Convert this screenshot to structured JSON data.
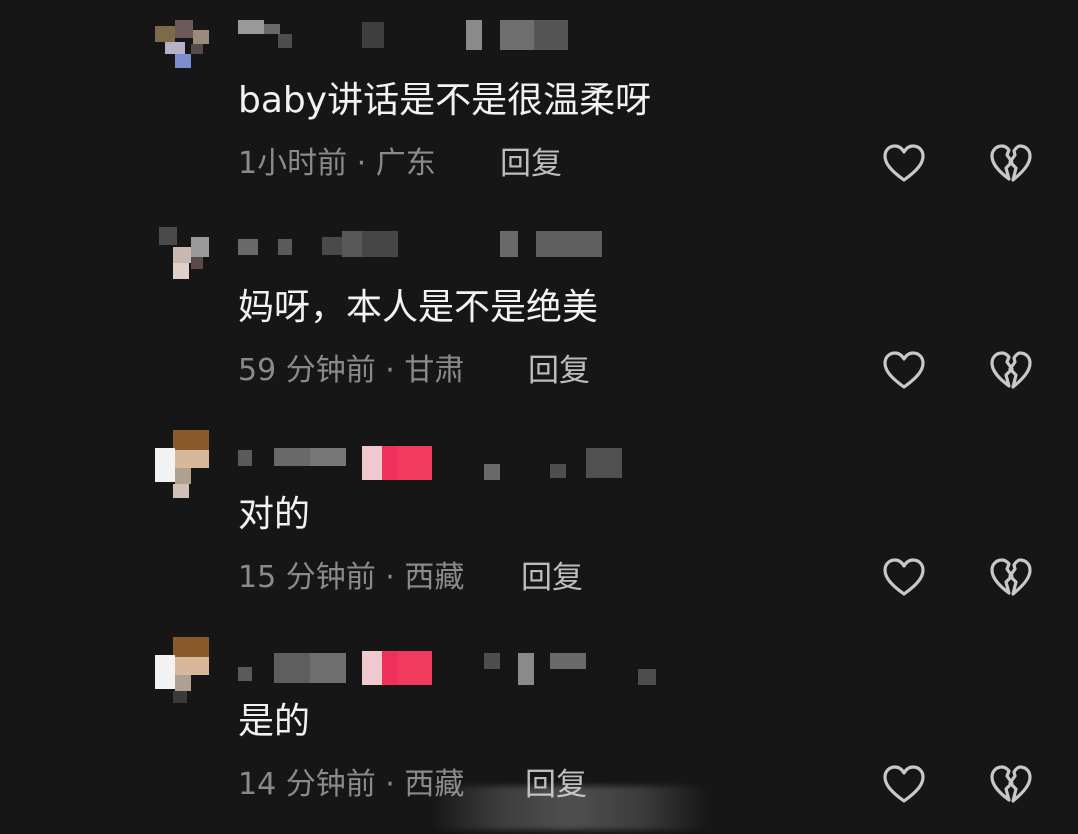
{
  "comments": [
    {
      "text": "baby讲话是不是很温柔呀",
      "meta": "1小时前 · 广东",
      "reply_label": "回复",
      "like_icon": "heart-outline-icon",
      "dislike_icon": "broken-heart-icon"
    },
    {
      "text": "妈呀，本人是不是绝美",
      "meta": "59 分钟前 · 甘肃",
      "reply_label": "回复",
      "like_icon": "heart-outline-icon",
      "dislike_icon": "broken-heart-icon"
    },
    {
      "text": "对的",
      "meta": "15 分钟前 · 西藏",
      "reply_label": "回复",
      "like_icon": "heart-outline-icon",
      "dislike_icon": "broken-heart-icon"
    },
    {
      "text": "是的",
      "meta": "14 分钟前 · 西藏",
      "reply_label": "回复",
      "like_icon": "heart-outline-icon",
      "dislike_icon": "broken-heart-icon"
    }
  ],
  "colors": {
    "background": "#161616",
    "comment_text": "#f2f2f2",
    "meta_text": "#8a8a8a",
    "reply_text": "#bdbdbd",
    "icon_stroke": "#c8c8c8",
    "badge_accent": "#f0305a"
  }
}
